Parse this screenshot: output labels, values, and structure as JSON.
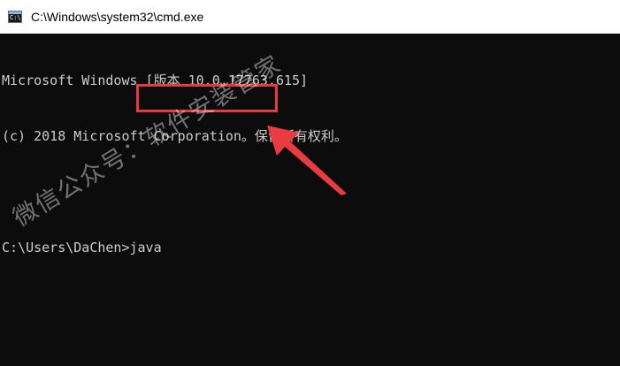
{
  "window": {
    "title": "C:\\Windows\\system32\\cmd.exe",
    "icon": "cmd-icon",
    "icon_glyph": "C:\\."
  },
  "console": {
    "lines": [
      "Microsoft Windows [版本 10.0.17763.615]",
      "(c) 2018 Microsoft Corporation。保留所有权利。",
      "",
      "C:\\Users\\DaChen>java"
    ]
  },
  "annotation": {
    "box_color": "#e53a40",
    "arrow_color": "#ea3b40"
  },
  "watermark": {
    "text": "微信公众号：软件安装管家"
  },
  "colors": {
    "console_bg": "#0c0c0c",
    "console_text": "#cccccc"
  }
}
